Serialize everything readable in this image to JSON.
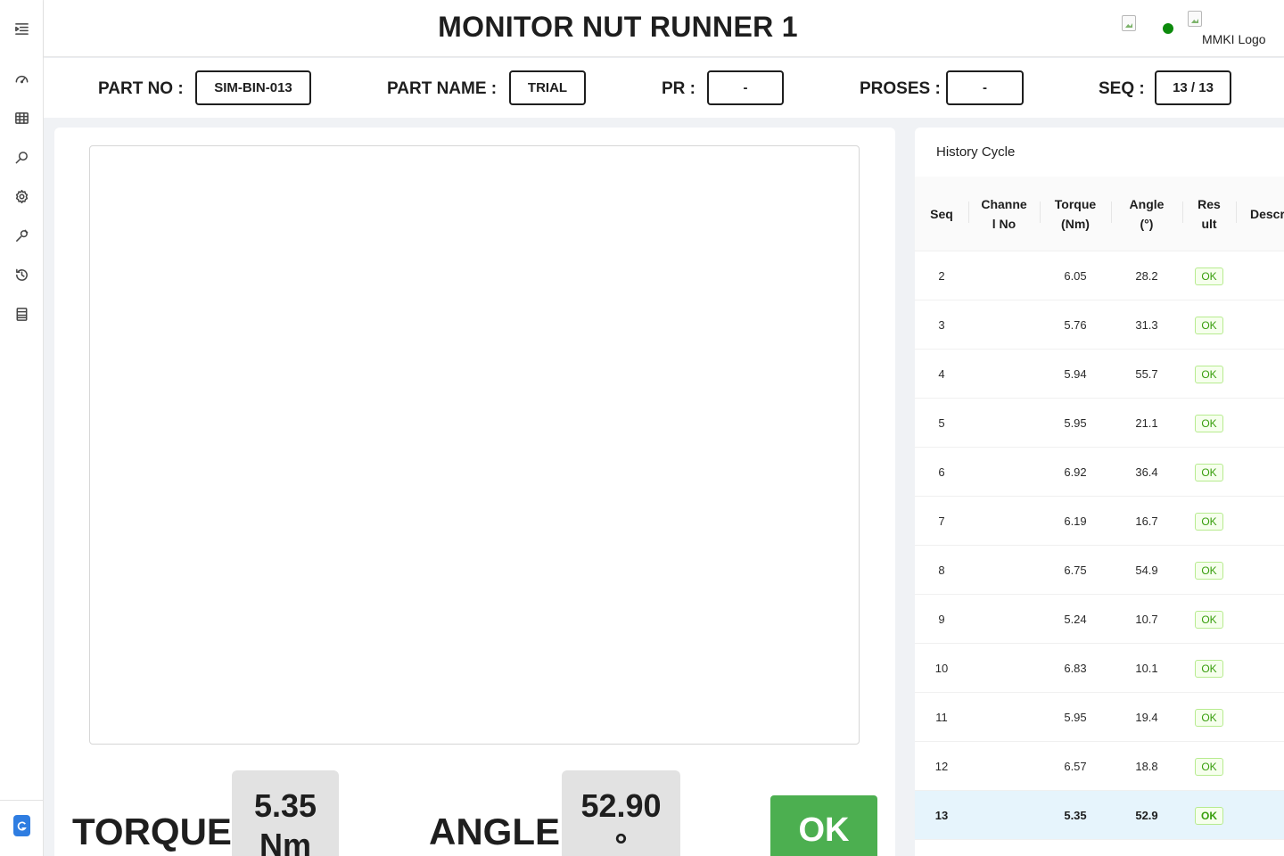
{
  "sidebar": {
    "icons": [
      "menu-fold-icon",
      "dashboard-icon",
      "table-icon",
      "search-icon",
      "settings-icon",
      "tool-icon",
      "history-icon",
      "report-icon",
      "app-icon"
    ]
  },
  "header": {
    "title": "MONITOR NUT RUNNER 1",
    "logo_alt": "MMKI Logo",
    "status_color": "#0c8a0c"
  },
  "info": {
    "part_no_label": "PART NO :",
    "part_no": "SIM-BIN-013",
    "part_name_label": "PART NAME :",
    "part_name": "TRIAL",
    "pr_label": "PR :",
    "pr": "-",
    "proses_label": "PROSES :",
    "proses": "-",
    "seq_label": "SEQ :",
    "seq": "13 / 13"
  },
  "measure": {
    "torque_label": "TORQUE",
    "torque_value": "5.35",
    "torque_unit": "Nm",
    "angle_label": "ANGLE",
    "angle_value": "52.90",
    "angle_unit": "°",
    "result": "OK",
    "result_color": "#4caf50"
  },
  "history": {
    "title": "History Cycle",
    "headers": {
      "seq": "Seq",
      "channel_1": "Channe",
      "channel_2": "l No",
      "torque_1": "Torque",
      "torque_2": "(Nm)",
      "angle_1": "Angle",
      "angle_2": "(°)",
      "result_1": "Res",
      "result_2": "ult",
      "descr": "Descr."
    },
    "rows": [
      {
        "seq": "2",
        "channel": "",
        "torque": "6.05",
        "angle": "28.2",
        "result": "OK",
        "description": ""
      },
      {
        "seq": "3",
        "channel": "",
        "torque": "5.76",
        "angle": "31.3",
        "result": "OK",
        "description": ""
      },
      {
        "seq": "4",
        "channel": "",
        "torque": "5.94",
        "angle": "55.7",
        "result": "OK",
        "description": ""
      },
      {
        "seq": "5",
        "channel": "",
        "torque": "5.95",
        "angle": "21.1",
        "result": "OK",
        "description": ""
      },
      {
        "seq": "6",
        "channel": "",
        "torque": "6.92",
        "angle": "36.4",
        "result": "OK",
        "description": ""
      },
      {
        "seq": "7",
        "channel": "",
        "torque": "6.19",
        "angle": "16.7",
        "result": "OK",
        "description": ""
      },
      {
        "seq": "8",
        "channel": "",
        "torque": "6.75",
        "angle": "54.9",
        "result": "OK",
        "description": ""
      },
      {
        "seq": "9",
        "channel": "",
        "torque": "5.24",
        "angle": "10.7",
        "result": "OK",
        "description": ""
      },
      {
        "seq": "10",
        "channel": "",
        "torque": "6.83",
        "angle": "10.1",
        "result": "OK",
        "description": ""
      },
      {
        "seq": "11",
        "channel": "",
        "torque": "5.95",
        "angle": "19.4",
        "result": "OK",
        "description": ""
      },
      {
        "seq": "12",
        "channel": "",
        "torque": "6.57",
        "angle": "18.8",
        "result": "OK",
        "description": ""
      },
      {
        "seq": "13",
        "channel": "",
        "torque": "5.35",
        "angle": "52.9",
        "result": "OK",
        "description": "",
        "active": true
      }
    ]
  }
}
